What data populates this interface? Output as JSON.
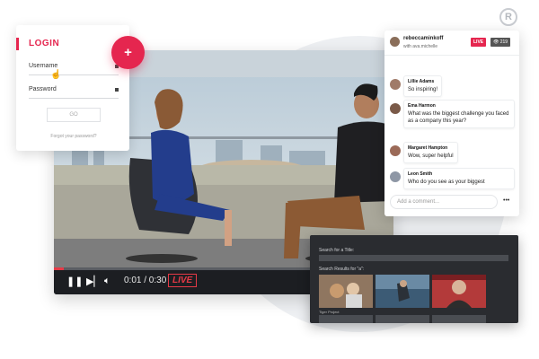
{
  "brand": {
    "mark": "R"
  },
  "login": {
    "title": "LOGIN",
    "username_label": "Username",
    "password_label": "Password",
    "submit_label": "GO",
    "forgot_label": "Forgot your password?",
    "fab_label": "+"
  },
  "player": {
    "time": "0:01 / 0:30",
    "live_label": "LIVE",
    "progress": 0.03
  },
  "chat": {
    "host": "rebeccaminkoff",
    "with_label": "with ava.michelle",
    "live_label": "LIVE",
    "viewers": "219",
    "messages": [
      {
        "name": "Lillie Adams",
        "text": "So inspiring!"
      },
      {
        "name": "Ema Harmon",
        "text": "What was the biggest challenge you faced as a company this year?"
      },
      {
        "name": "Margaret Hampton",
        "text": "Wow, super helpful"
      },
      {
        "name": "Leon Smith",
        "text": "Who do you see as your biggest"
      }
    ],
    "input_placeholder": "Add a comment...",
    "more_label": "•••"
  },
  "search": {
    "title_label": "Search for a Title:",
    "results_label": "Search Results for \"a\":",
    "captions": [
      "Tiger Project",
      "",
      "",
      ""
    ]
  },
  "colors": {
    "accent": "#e5264f",
    "live_red": "#e63946",
    "player_dark": "#1c1e22"
  }
}
